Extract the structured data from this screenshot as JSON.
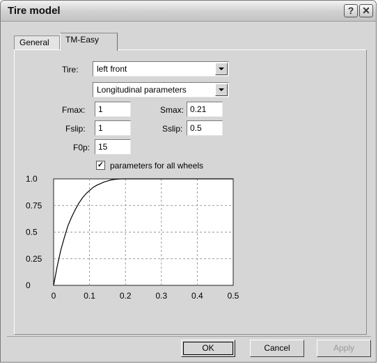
{
  "window": {
    "title": "Tire model",
    "help_glyph": "?",
    "close_glyph": "✕"
  },
  "tabs": [
    {
      "label": "General",
      "active": false
    },
    {
      "label": "TM-Easy",
      "active": true
    }
  ],
  "form": {
    "tire_label": "Tire:",
    "tire_value": "left front",
    "param_type_value": "Longitudinal parameters",
    "fmax_label": "Fmax:",
    "fmax_value": "1",
    "smax_label": "Smax:",
    "smax_value": "0.21",
    "fslip_label": "Fslip:",
    "fslip_value": "1",
    "sslip_label": "Sslip:",
    "sslip_value": "0.5",
    "f0p_label": "F0p:",
    "f0p_value": "15",
    "all_wheels_checked": true,
    "all_wheels_label": "parameters for all wheels"
  },
  "chart_data": {
    "type": "line",
    "title": "",
    "xlabel": "",
    "ylabel": "",
    "xlim": [
      0,
      0.5
    ],
    "ylim": [
      0,
      1.0
    ],
    "x_ticks": [
      "0",
      "0.1",
      "0.2",
      "0.3",
      "0.4",
      "0.5"
    ],
    "y_ticks": [
      "0",
      "0.25",
      "0.5",
      "0.75",
      "1.0"
    ],
    "grid": true,
    "series": [
      {
        "x": [
          0,
          0.01,
          0.02,
          0.03,
          0.04,
          0.05,
          0.06,
          0.07,
          0.08,
          0.09,
          0.1,
          0.11,
          0.12,
          0.13,
          0.14,
          0.15,
          0.16,
          0.17,
          0.18,
          0.19,
          0.2,
          0.21,
          0.3,
          0.4,
          0.5
        ],
        "y": [
          0,
          0.18,
          0.33,
          0.45,
          0.56,
          0.64,
          0.71,
          0.77,
          0.82,
          0.86,
          0.89,
          0.92,
          0.94,
          0.955,
          0.97,
          0.98,
          0.99,
          0.995,
          0.998,
          1.0,
          1.0,
          1.0,
          1.0,
          1.0,
          1.0
        ]
      }
    ]
  },
  "buttons": {
    "ok": "OK",
    "cancel": "Cancel",
    "apply": "Apply"
  }
}
